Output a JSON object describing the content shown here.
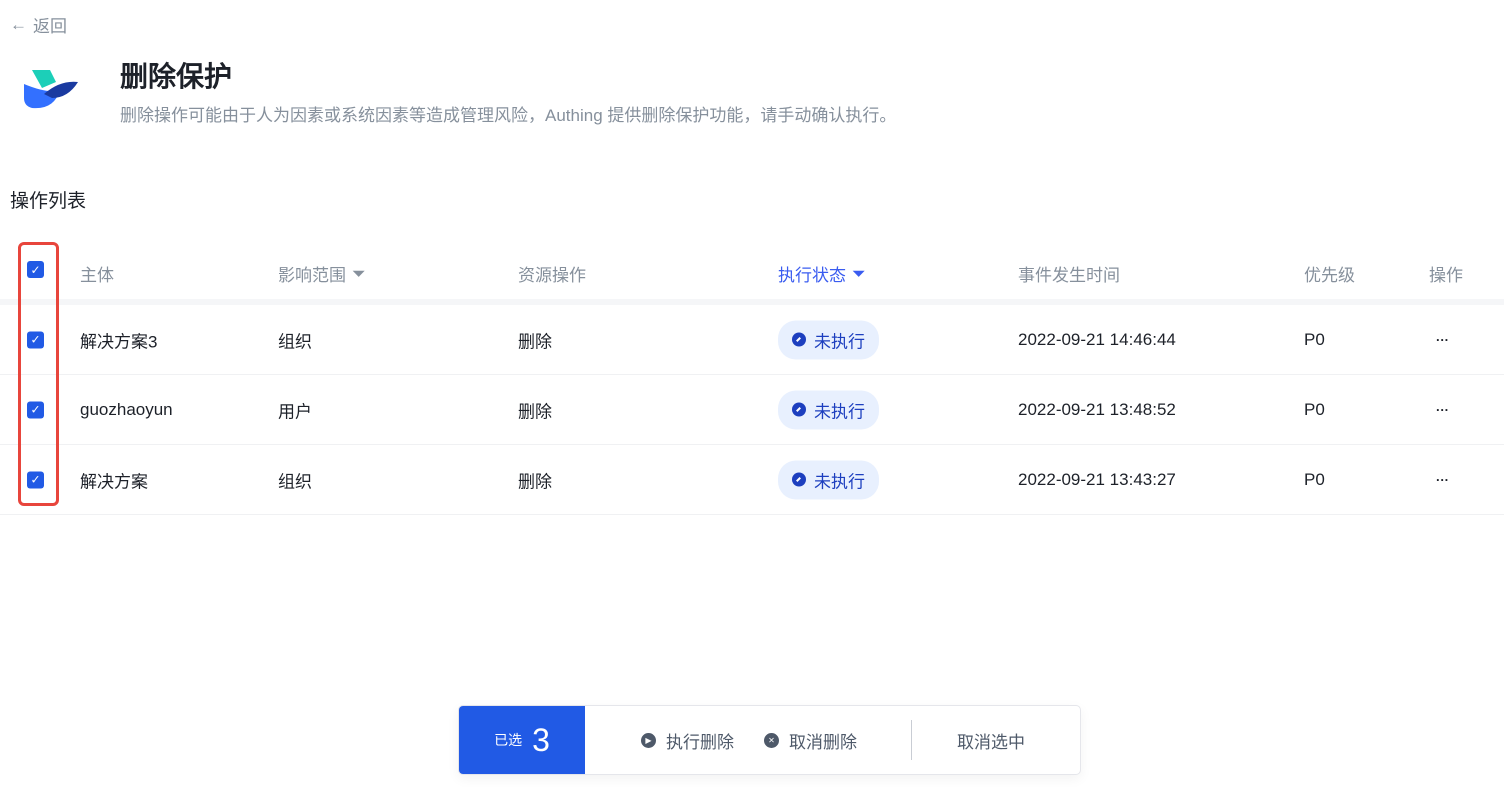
{
  "header": {
    "back": "返回",
    "title": "删除保护",
    "description": "删除操作可能由于人为因素或系统因素等造成管理风险，Authing 提供删除保护功能，请手动确认执行。"
  },
  "section_title": "操作列表",
  "columns": {
    "subject": "主体",
    "scope": "影响范围",
    "resource_op": "资源操作",
    "status": "执行状态",
    "time": "事件发生时间",
    "priority": "优先级",
    "actions": "操作"
  },
  "rows": [
    {
      "subject": "解决方案3",
      "scope": "组织",
      "resource_op": "删除",
      "status": "未执行",
      "time": "2022-09-21 14:46:44",
      "priority": "P0",
      "more": "···"
    },
    {
      "subject": "guozhaoyun",
      "scope": "用户",
      "resource_op": "删除",
      "status": "未执行",
      "time": "2022-09-21 13:48:52",
      "priority": "P0",
      "more": "···"
    },
    {
      "subject": "解决方案",
      "scope": "组织",
      "resource_op": "删除",
      "status": "未执行",
      "time": "2022-09-21 13:43:27",
      "priority": "P0",
      "more": "···"
    }
  ],
  "bulk_bar": {
    "selected_label": "已选",
    "selected_count": "3",
    "execute": "执行删除",
    "cancel_delete": "取消删除",
    "deselect": "取消选中"
  },
  "colors": {
    "primary": "#215ae5",
    "highlight": "#e8453c"
  }
}
